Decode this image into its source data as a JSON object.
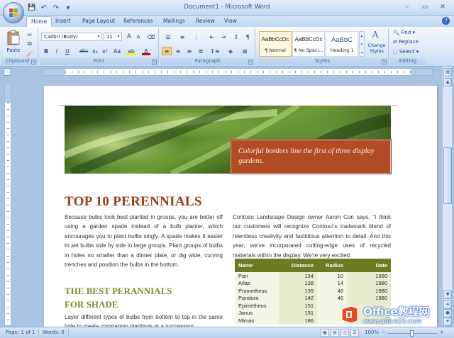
{
  "window": {
    "title": "Document1 - Microsoft Word",
    "min": "–",
    "max": "▭",
    "close": "✕"
  },
  "qat": {
    "save": "💾",
    "undo": "↶",
    "redo": "↷",
    "more": "▾"
  },
  "tabs": [
    {
      "label": "Home"
    },
    {
      "label": "Insert"
    },
    {
      "label": "Page Layout"
    },
    {
      "label": "References"
    },
    {
      "label": "Mailings"
    },
    {
      "label": "Review"
    },
    {
      "label": "View"
    }
  ],
  "ribbon": {
    "clipboard": {
      "label": "Clipboard",
      "paste": "Paste"
    },
    "font": {
      "label": "Font",
      "family": "Calibri (Body)",
      "size": "11",
      "grow": "A",
      "shrink": "A",
      "bold": "B",
      "italic": "I",
      "underline": "U",
      "strike": "abc",
      "sub": "x₂",
      "sup": "x²",
      "case": "Aa",
      "color": "A"
    },
    "paragraph": {
      "label": "Paragraph"
    },
    "styles": {
      "label": "Styles",
      "change": "Change Styles",
      "items": [
        {
          "sample": "AaBbCcDc",
          "name": "¶ Normal"
        },
        {
          "sample": "AaBbCcDc",
          "name": "¶ No Spaci..."
        },
        {
          "sample": "AaBbC",
          "name": "Heading 1"
        }
      ]
    },
    "editing": {
      "label": "Editing",
      "find": "Find",
      "replace": "Replace",
      "select": "Select"
    }
  },
  "document": {
    "caption": "Colorful borders line the first of three display gardens.",
    "title": "TOP 10 PERENNIALS",
    "para1": "Because bulbs look best planted in groups, you are better off using a garden spade instead of a bulb planter, which encourages you to plant bulbs singly. A spade makes it easier to set bulbs side by side in large groups. Plant groups of bulbs in holes no smaller than a dinner plate, or dig wide, curving trenches and position the bulbs in the bottom.",
    "subtitle1": "THE BEST PERANNIALS",
    "subtitle2": "FOR SHADE",
    "para2": "Layer different types of bulbs from bottom to top in the same hole to create companion plantings or a succession",
    "para3": "Contoso Landscape Design owner Aaron Con says, “I think our customers will recognize Contoso’s trademark blend of relentless creativity and fastidious attention to detail. And this year, we’ve incorporated cutting-edge uses of recycled materials within the display. We’re very excited",
    "table": {
      "headers": [
        "Name",
        "Distance",
        "Radius",
        "Date"
      ],
      "rows": [
        [
          "Pan",
          "134",
          "10",
          "1990"
        ],
        [
          "Atlas",
          "138",
          "14",
          "1980"
        ],
        [
          "Prometheus",
          "139",
          "46",
          "1980"
        ],
        [
          "Pandora",
          "142",
          "46",
          "1980"
        ],
        [
          "Epimetheus",
          "151",
          "",
          ""
        ],
        [
          "Janus",
          "151",
          "",
          ""
        ],
        [
          "Mimas",
          "186",
          "",
          ""
        ]
      ]
    }
  },
  "status": {
    "page": "Page: 1 of 1",
    "words": "Words: 0",
    "zoom": "100%",
    "zoom_minus": "−",
    "zoom_plus": "+"
  },
  "watermark": {
    "line1": "Office教程网",
    "line2": "www.office26.com"
  },
  "colors": {
    "accent": "#b24c26",
    "title": "#a23a17",
    "subtitle": "#7a8e2e",
    "table_header": "#6b7b22"
  }
}
